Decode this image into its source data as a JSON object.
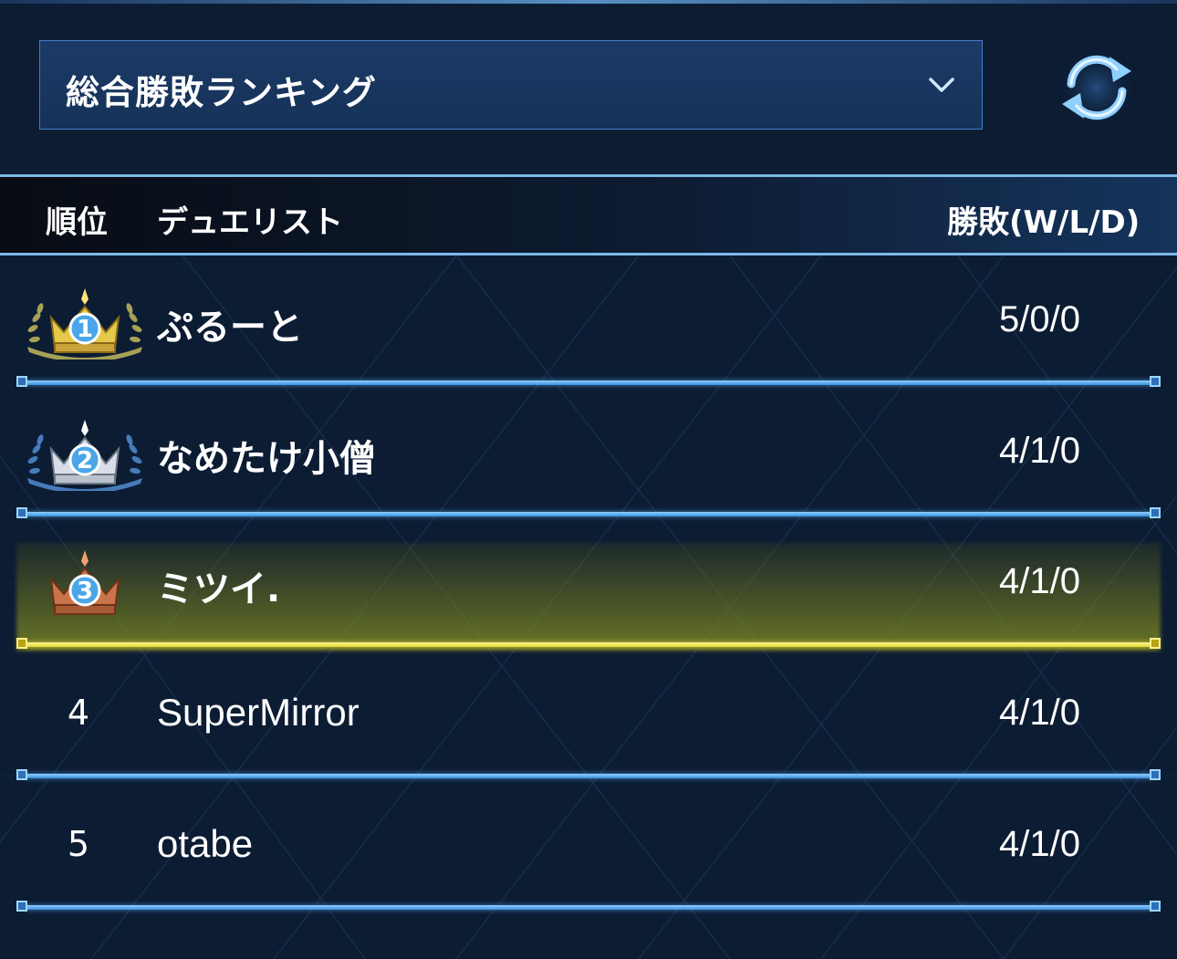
{
  "ranking_selector": {
    "label": "総合勝敗ランキング",
    "chevron_icon": "chevron-down-icon"
  },
  "refresh_button": {
    "icon": "refresh-icon"
  },
  "table_header": {
    "rank": "順位",
    "duelist": "デュエリスト",
    "record": "勝敗(W/L/D)"
  },
  "rows": [
    {
      "rank": "1",
      "badge": "gold-crown-icon",
      "name": "ぷるーと",
      "record": "5/0/0"
    },
    {
      "rank": "2",
      "badge": "silver-crown-icon",
      "name": "なめたけ小僧",
      "record": "4/1/0"
    },
    {
      "rank": "3",
      "badge": "bronze-crown-icon",
      "name": "ミツイ.",
      "record": "4/1/0",
      "highlighted": true
    },
    {
      "rank": "4",
      "name": "SuperMirror",
      "record": "4/1/0"
    },
    {
      "rank": "5",
      "name": "otabe",
      "record": "4/1/0"
    }
  ],
  "colors": {
    "background": "#0c1c33",
    "accent_blue": "#4da3e8",
    "highlight_yellow": "#e6d62a"
  }
}
